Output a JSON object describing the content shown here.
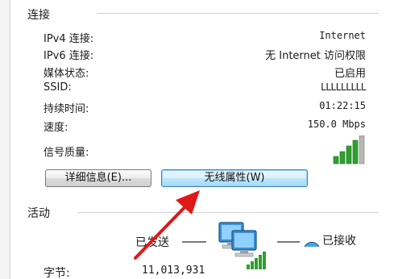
{
  "connection": {
    "title": "连接",
    "rows": [
      {
        "label": "IPv4 连接:",
        "value": "Internet"
      },
      {
        "label": "IPv6 连接:",
        "value": "无 Internet 访问权限"
      },
      {
        "label": "媒体状态:",
        "value": "已启用"
      },
      {
        "label": "SSID:",
        "value": "LLLLLLLLL"
      },
      {
        "label": "持续时间:",
        "value": "01:22:15"
      },
      {
        "label": "速度:",
        "value": "150.0 Mbps"
      }
    ],
    "signal_label": "信号质量:",
    "signal_icon": "wifi-signal-bars-icon",
    "signal_bars_level": 0.8,
    "details_button": "详细信息(E)...",
    "wireless_props_button": "无线属性(W)"
  },
  "activity": {
    "title": "活动",
    "sent_label": "已发送",
    "received_label": "已接收",
    "bytes_label": "字节:",
    "bytes_sent": "11,013,931",
    "network_icon": "network-computers-icon"
  },
  "colors": {
    "arrow": "#e01818",
    "signal_green": "#2ea02e",
    "active_button_border": "#3c7fb1"
  }
}
